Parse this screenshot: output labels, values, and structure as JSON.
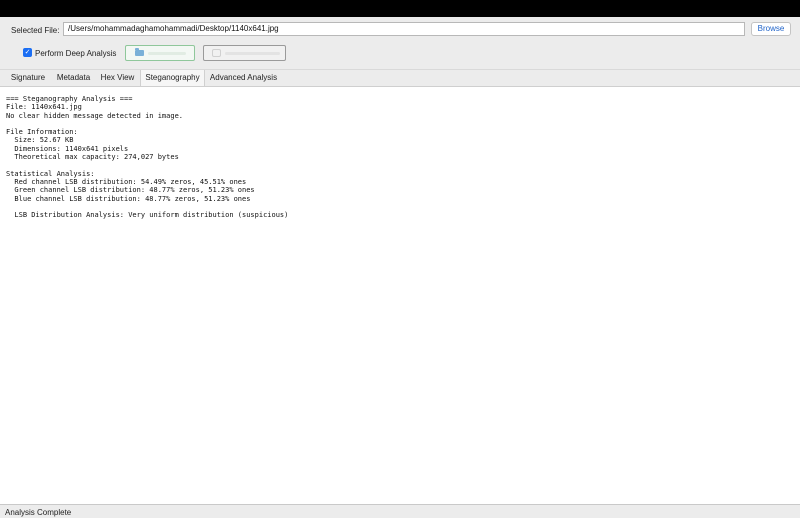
{
  "file": {
    "label": "Selected File:",
    "path": "/Users/mohammadaghamohammadi/Desktop/1140x641.jpg",
    "browse_label": "Browse"
  },
  "options": {
    "deep_analysis_label": "Perform Deep Analysis",
    "deep_analysis_checked": true
  },
  "tabs": [
    {
      "label": "Signature",
      "active": false
    },
    {
      "label": "Metadata",
      "active": false
    },
    {
      "label": "Hex View",
      "active": false
    },
    {
      "label": "Steganography",
      "active": true
    },
    {
      "label": "Advanced Analysis",
      "active": false
    }
  ],
  "output": {
    "lines": [
      "=== Steganography Analysis ===",
      "File: 1140x641.jpg",
      "No clear hidden message detected in image.",
      "",
      "File Information:",
      "  Size: 52.67 KB",
      "  Dimensions: 1140x641 pixels",
      "  Theoretical max capacity: 274,027 bytes",
      "",
      "Statistical Analysis:",
      "  Red channel LSB distribution: 54.49% zeros, 45.51% ones",
      "  Green channel LSB distribution: 48.77% zeros, 51.23% ones",
      "  Blue channel LSB distribution: 48.77% zeros, 51.23% ones",
      "",
      "  LSB Distribution Analysis: Very uniform distribution (suspicious)"
    ]
  },
  "status": {
    "text": "Analysis Complete"
  },
  "colors": {
    "accent": "#1b6ef3",
    "browse_text": "#1f63c9",
    "analyze_border": "#8fc79b"
  },
  "icons": {
    "analyze": "folder-icon",
    "export": "export-icon",
    "checkbox": "checkmark-icon"
  }
}
